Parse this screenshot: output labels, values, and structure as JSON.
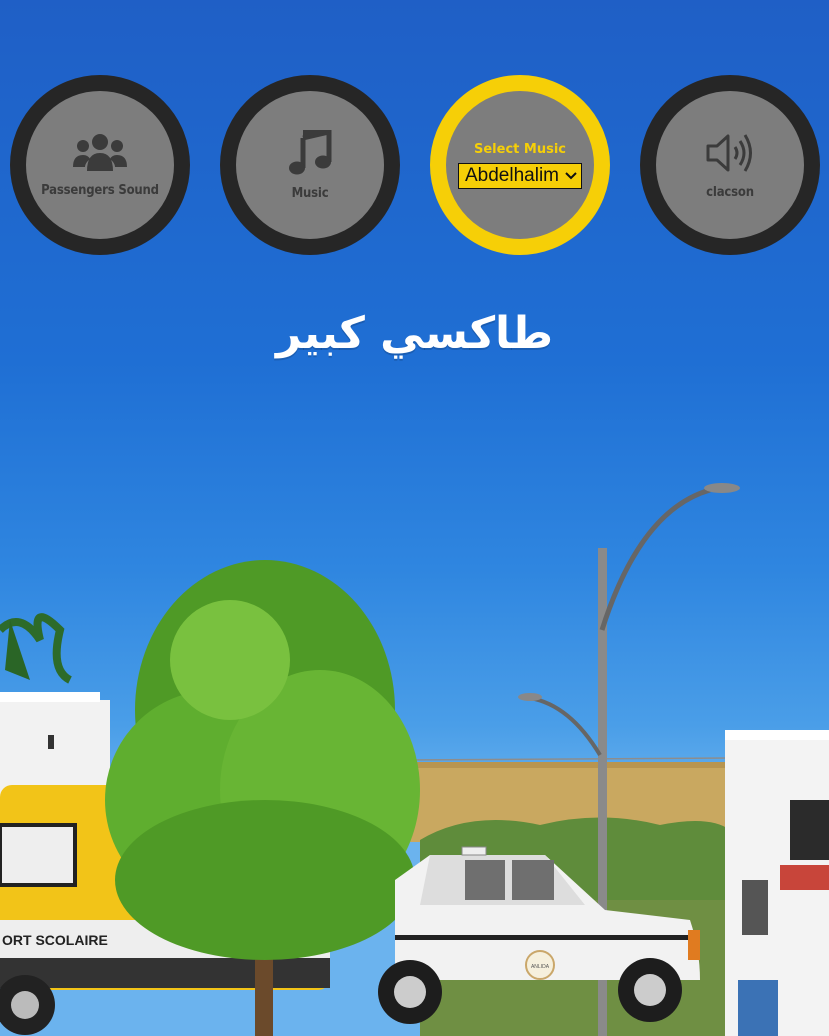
{
  "controls": [
    {
      "id": "passengers",
      "label": "Passengers Sound",
      "icon": "users-icon"
    },
    {
      "id": "music",
      "label": "Music",
      "icon": "music-note-icon"
    },
    {
      "id": "select",
      "label": "Select Music",
      "selected": "Abdelhalim",
      "icon": "chevron-down-icon"
    },
    {
      "id": "clacson",
      "label": "clacson",
      "icon": "speaker-icon"
    }
  ],
  "title": "طاكسي كبير",
  "vehicles": {
    "bus_text": "ORT SCOLAIRE",
    "taxi_badge": "ANLIDA"
  },
  "colors": {
    "accent": "#f6cf07",
    "button_ring": "#262626",
    "button_fill": "#7d7d7d",
    "sky": "#1f6fd4"
  }
}
